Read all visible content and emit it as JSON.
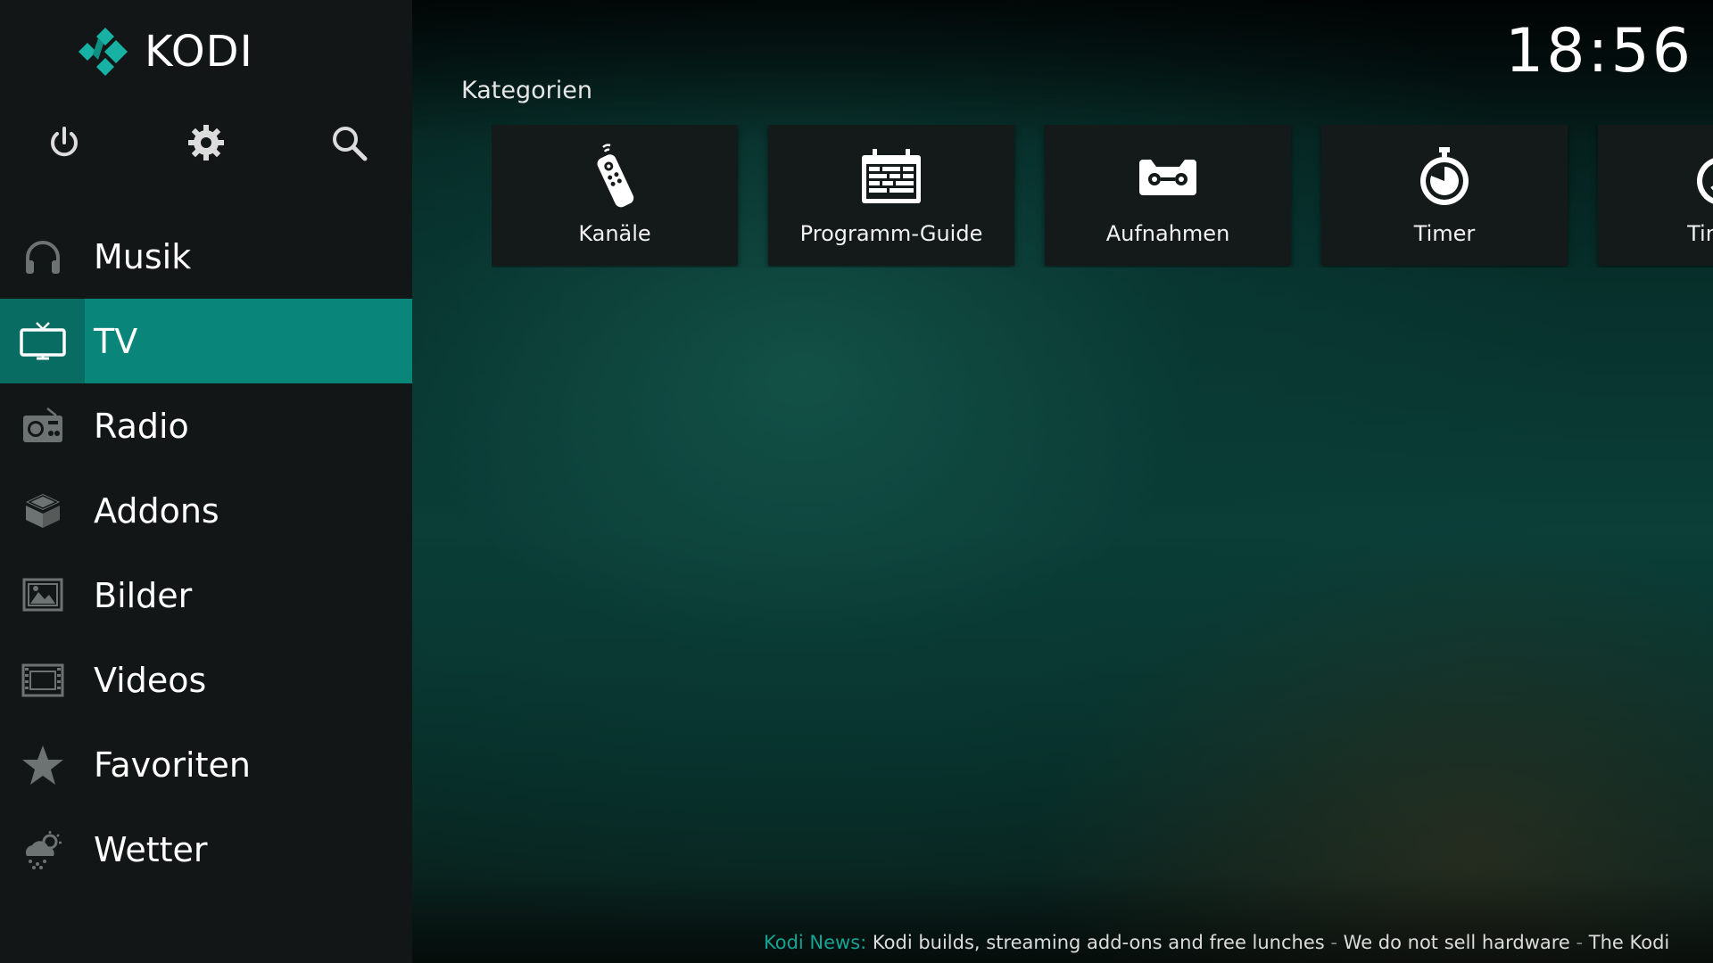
{
  "app": {
    "name": "KODI"
  },
  "clock": "18:56",
  "sidebar": {
    "top_icons": [
      {
        "name": "power-icon"
      },
      {
        "name": "gear-icon"
      },
      {
        "name": "search-icon"
      }
    ],
    "items": [
      {
        "label": "Musik",
        "icon": "headphones-icon",
        "active": false
      },
      {
        "label": "TV",
        "icon": "tv-icon",
        "active": true
      },
      {
        "label": "Radio",
        "icon": "radio-icon",
        "active": false
      },
      {
        "label": "Addons",
        "icon": "addons-box-icon",
        "active": false
      },
      {
        "label": "Bilder",
        "icon": "picture-icon",
        "active": false
      },
      {
        "label": "Videos",
        "icon": "film-icon",
        "active": false
      },
      {
        "label": "Favoriten",
        "icon": "star-icon",
        "active": false
      },
      {
        "label": "Wetter",
        "icon": "weather-icon",
        "active": false
      }
    ]
  },
  "main": {
    "section_title": "Kategorien",
    "tiles": [
      {
        "label": "Kanäle",
        "icon": "remote-icon"
      },
      {
        "label": "Programm-Guide",
        "icon": "calendar-guide-icon"
      },
      {
        "label": "Aufnahmen",
        "icon": "cassette-icon"
      },
      {
        "label": "Timer",
        "icon": "stopwatch-icon"
      },
      {
        "label": "Timer-",
        "icon": "timer-rule-icon"
      }
    ]
  },
  "ticker": {
    "label": "Kodi News:",
    "items": [
      "Kodi builds, streaming add-ons and free lunches",
      "We do not sell hardware",
      "The Kodi"
    ],
    "separator": "-"
  },
  "colors": {
    "accent": "#0a8579",
    "accent_dark": "#086c62",
    "sidebar_bg": "#121616",
    "tile_bg": "#141a19",
    "ticker_label": "#12a594"
  }
}
